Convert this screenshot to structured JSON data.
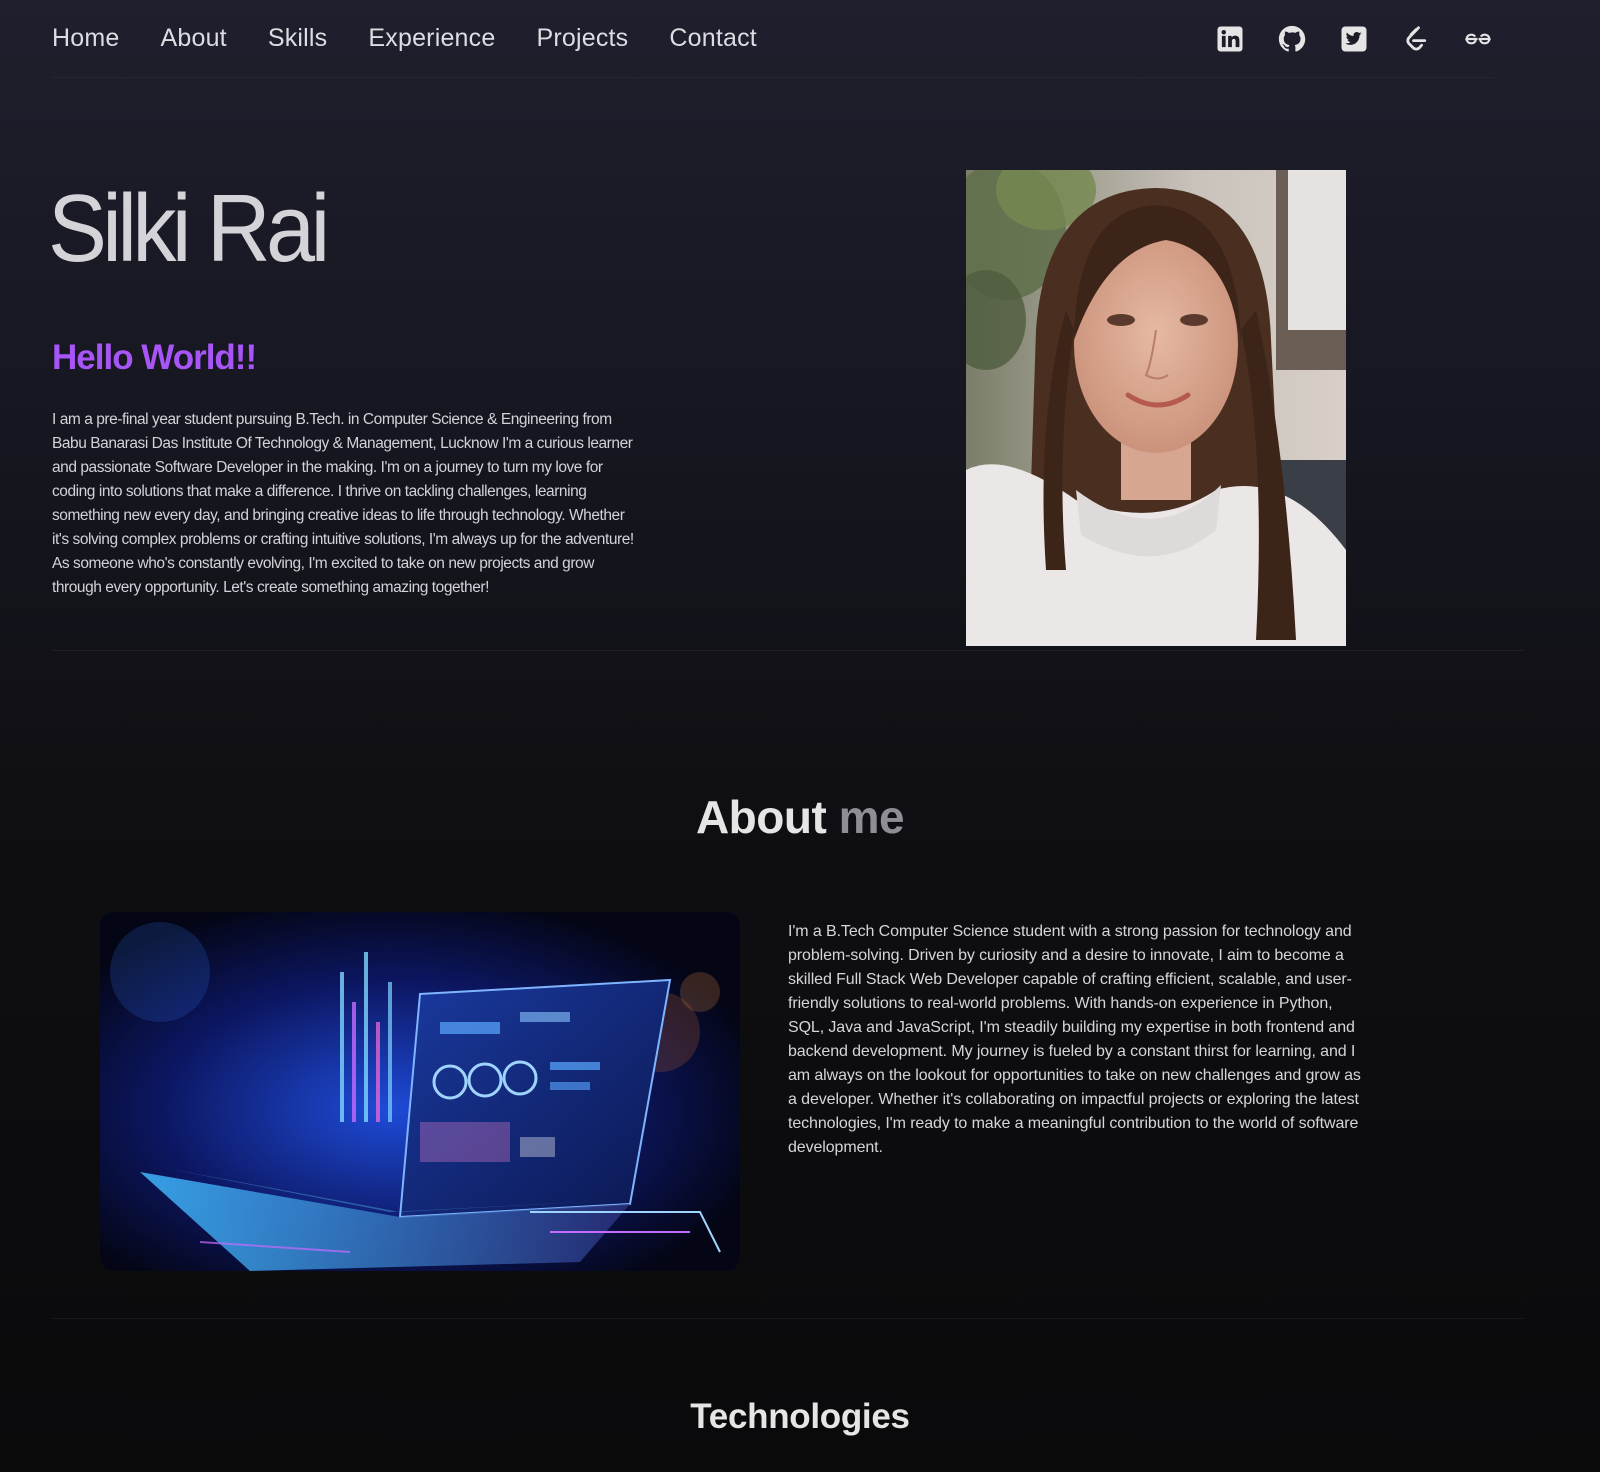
{
  "nav": {
    "links": [
      "Home",
      "About",
      "Skills",
      "Experience",
      "Projects",
      "Contact"
    ],
    "icons": [
      "linkedin-icon",
      "github-icon",
      "twitter-icon",
      "leetcode-icon",
      "geeksforgeeks-icon"
    ]
  },
  "hero": {
    "name": "Silki Rai",
    "greeting": "Hello World!!",
    "bio": "I am a pre-final year student pursuing B.Tech. in Computer Science & Engineering from Babu Banarasi Das Institute Of Technology & Management, Lucknow I'm a curious learner and passionate Software Developer in the making. I'm on a journey to turn my love for coding into solutions that make a difference. I thrive on tackling challenges, learning something new every day, and bringing creative ideas to life through technology. Whether it's solving complex problems or crafting intuitive solutions, I'm always up for the adventure! As someone who's constantly evolving, I'm excited to take on new projects and grow through every opportunity. Let's create something amazing together!"
  },
  "about": {
    "title_main": "About",
    "title_muted": "me",
    "text": "I'm a B.Tech Computer Science student with a strong passion for technology and problem-solving. Driven by curiosity and a desire to innovate, I aim to become a skilled Full Stack Web Developer capable of crafting efficient, scalable, and user-friendly solutions to real-world problems. With hands-on experience in Python, SQL, Java and JavaScript, I'm steadily building my expertise in both frontend and backend development. My journey is fueled by a constant thirst for learning, and I am always on the lookout for opportunities to take on new challenges and grow as a developer. Whether it's collaborating on impactful projects or exploring the latest technologies, I'm ready to make a meaningful contribution to the world of software development."
  },
  "technologies": {
    "title": "Technologies"
  },
  "colors": {
    "accent": "#a855f7",
    "background_top": "#1f1f2d",
    "background_bottom": "#0a0a0b"
  }
}
